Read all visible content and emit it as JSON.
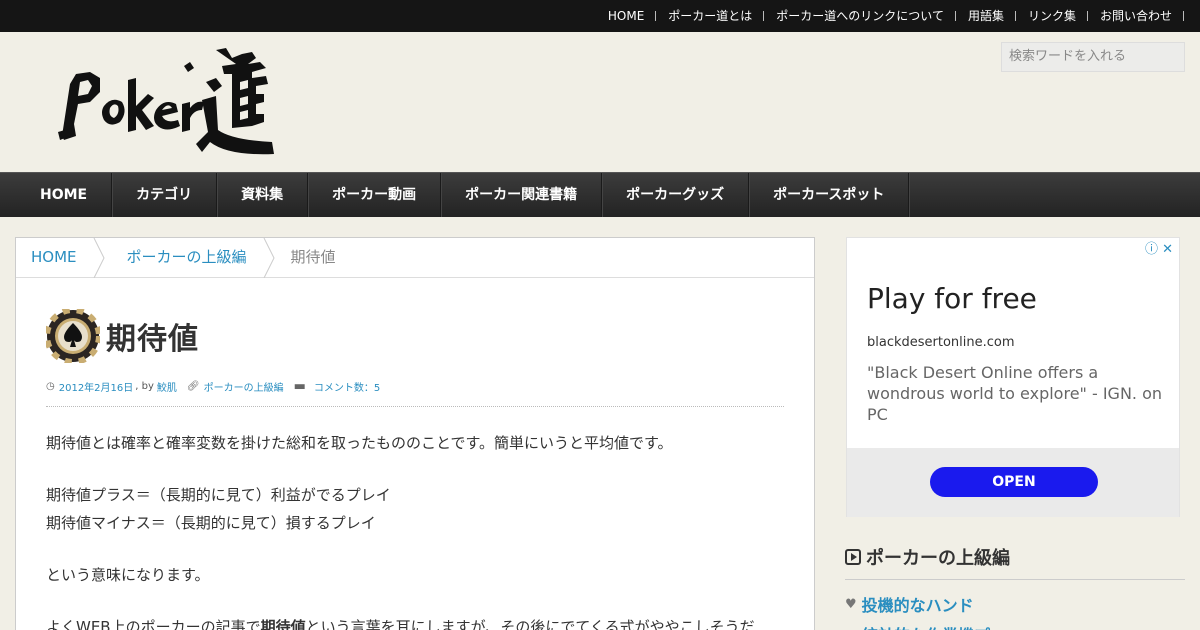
{
  "topnav": {
    "items": [
      "HOME",
      "ポーカー道とは",
      "ポーカー道へのリンクについて",
      "用語集",
      "リンク集",
      "お問い合わせ"
    ]
  },
  "header": {
    "logo_text": "Poker道",
    "search_placeholder": "検索ワードを入れる"
  },
  "mainnav": {
    "items": [
      "HOME",
      "カテゴリ",
      "資料集",
      "ポーカー動画",
      "ポーカー関連書籍",
      "ポーカーグッズ",
      "ポーカースポット"
    ]
  },
  "breadcrumb": {
    "home": "HOME",
    "category": "ポーカーの上級編",
    "current": "期待値"
  },
  "article": {
    "title": "期待値",
    "date": "2012年2月16日",
    "by": ", by",
    "author": "鮫肌",
    "category": "ポーカーの上級編",
    "comments": "コメント数：5",
    "p1": "期待値とは確率と確率変数を掛けた総和を取ったもののことです。簡単にいうと平均値です。",
    "p2": "期待値プラス＝（長期的に見て）利益がでるプレイ",
    "p3": "期待値マイナス＝（長期的に見て）損するプレイ",
    "p4": "という意味になります。",
    "p5_a": "よくWEB上のポーカーの記事で",
    "p5_b": "期待値",
    "p5_c": "という言葉を耳にしますが、その後にでてくる式がややこしそうだ"
  },
  "ad": {
    "icons": "ⓘ ✕",
    "title": "Play for free",
    "domain": "blackdesertonline.com",
    "description": "\"Black Desert Online offers a wondrous world to explore\" - IGN. on PC",
    "button": "OPEN"
  },
  "sidebar": {
    "section_title": "ポーカーの上級編",
    "item1": "投機的なハンド",
    "item2": "統計的な作業機プ"
  },
  "colors": {
    "link": "#2a8ec0",
    "topbar": "#151515",
    "nav": "#2a2a2a",
    "ad_button": "#1a1aee"
  }
}
